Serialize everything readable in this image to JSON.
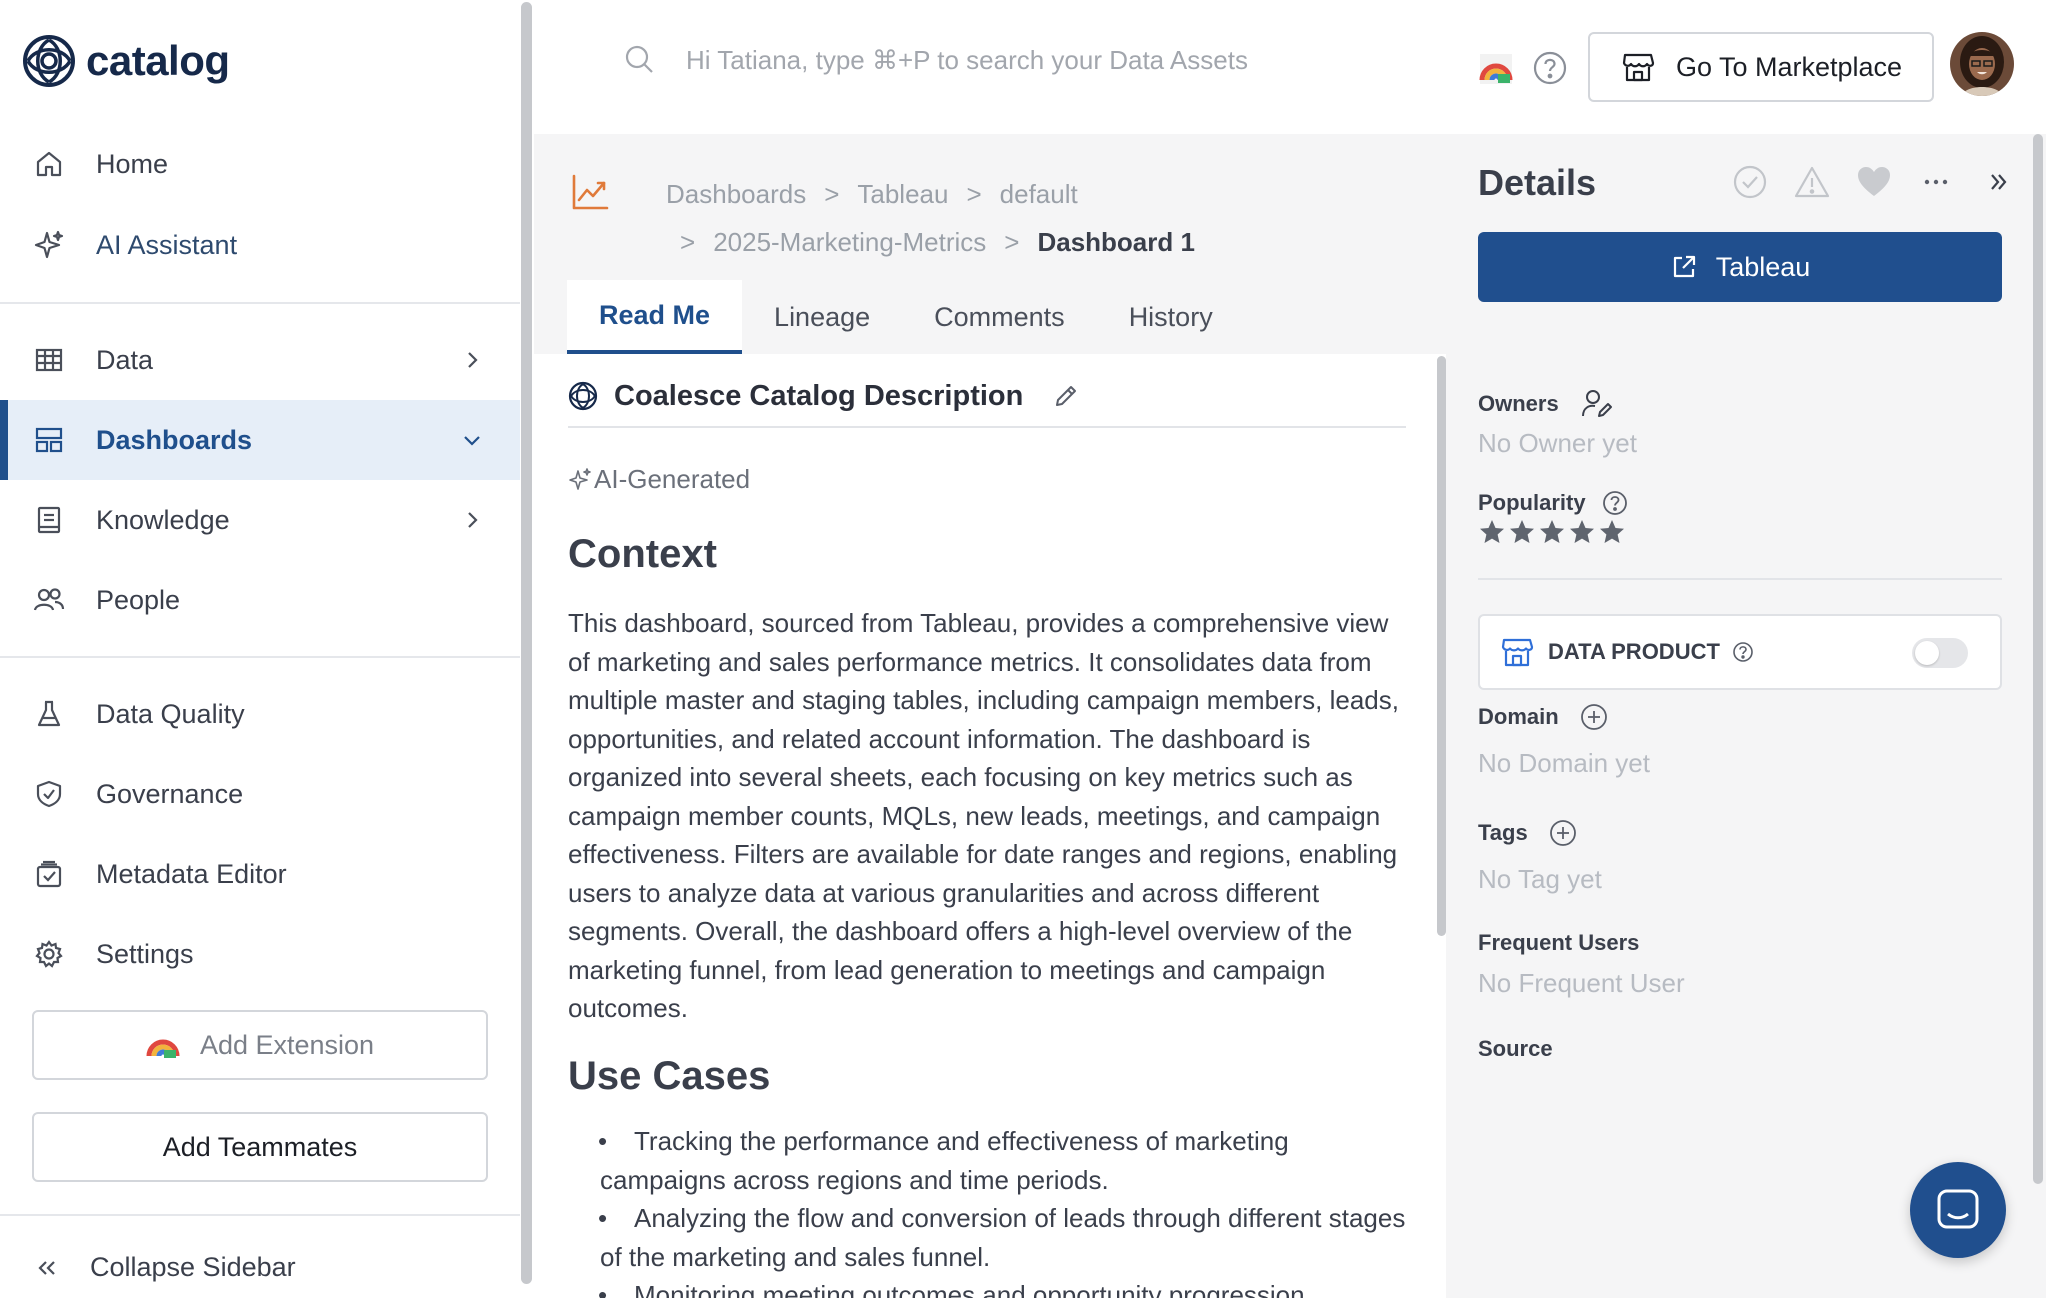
{
  "app": {
    "name": "catalog"
  },
  "sidebar": {
    "items": [
      {
        "label": "Home",
        "icon": "home-icon"
      },
      {
        "label": "AI Assistant",
        "icon": "sparkle-icon"
      },
      {
        "label": "Data",
        "icon": "table-icon",
        "expandable": true
      },
      {
        "label": "Dashboards",
        "icon": "dashboard-icon",
        "expandable": true,
        "active": true
      },
      {
        "label": "Knowledge",
        "icon": "book-icon",
        "expandable": true
      },
      {
        "label": "People",
        "icon": "people-icon"
      },
      {
        "label": "Data Quality",
        "icon": "flask-icon"
      },
      {
        "label": "Governance",
        "icon": "shield-icon"
      },
      {
        "label": "Metadata Editor",
        "icon": "calendar-check-icon"
      },
      {
        "label": "Settings",
        "icon": "gear-icon"
      }
    ],
    "add_extension_label": "Add Extension",
    "add_teammates_label": "Add Teammates",
    "collapse_label": "Collapse Sidebar"
  },
  "topbar": {
    "search_placeholder": "Hi Tatiana, type ⌘+P to search your Data Assets",
    "marketplace_label": "Go To Marketplace"
  },
  "breadcrumb": {
    "items": [
      "Dashboards",
      "Tableau",
      "default",
      "2025-Marketing-Metrics"
    ],
    "current": "Dashboard 1",
    "separator": ">"
  },
  "tabs": [
    {
      "label": "Read Me",
      "active": true
    },
    {
      "label": "Lineage"
    },
    {
      "label": "Comments"
    },
    {
      "label": "History"
    }
  ],
  "readme": {
    "heading": "Coalesce Catalog Description",
    "ai_tag": "AI-Generated",
    "context_title": "Context",
    "context_text": "This dashboard, sourced from Tableau, provides a comprehensive view of marketing and sales performance metrics. It consolidates data from multiple master and staging tables, including campaign members, leads, opportunities, and related account information. The dashboard is organized into several sheets, each focusing on key metrics such as campaign member counts, MQLs, new leads, meetings, and campaign effectiveness. Filters are available for date ranges and regions, enabling users to analyze data at various granularities and across different segments. Overall, the dashboard offers a high-level overview of the marketing funnel, from lead generation to meetings and campaign outcomes.",
    "use_cases_title": "Use Cases",
    "use_cases": [
      "Tracking the performance and effectiveness of marketing campaigns across regions and time periods.",
      "Analyzing the flow and conversion of leads through different stages of the marketing and sales funnel.",
      "Monitoring meeting outcomes and opportunity progression"
    ]
  },
  "details": {
    "title": "Details",
    "open_button_label": "Tableau",
    "owners_label": "Owners",
    "owners_empty": "No Owner yet",
    "popularity_label": "Popularity",
    "popularity_stars": 5,
    "data_product_label": "DATA PRODUCT",
    "data_product_enabled": false,
    "domain_label": "Domain",
    "domain_empty": "No Domain yet",
    "tags_label": "Tags",
    "tags_empty": "No Tag yet",
    "frequent_users_label": "Frequent Users",
    "frequent_users_empty": "No Frequent User",
    "source_label": "Source"
  },
  "colors": {
    "accent": "#204f8e",
    "active_bg": "#e6eef8",
    "panel_bg": "#f5f5f6",
    "breadcrumb_icon": "#e07a3a"
  }
}
